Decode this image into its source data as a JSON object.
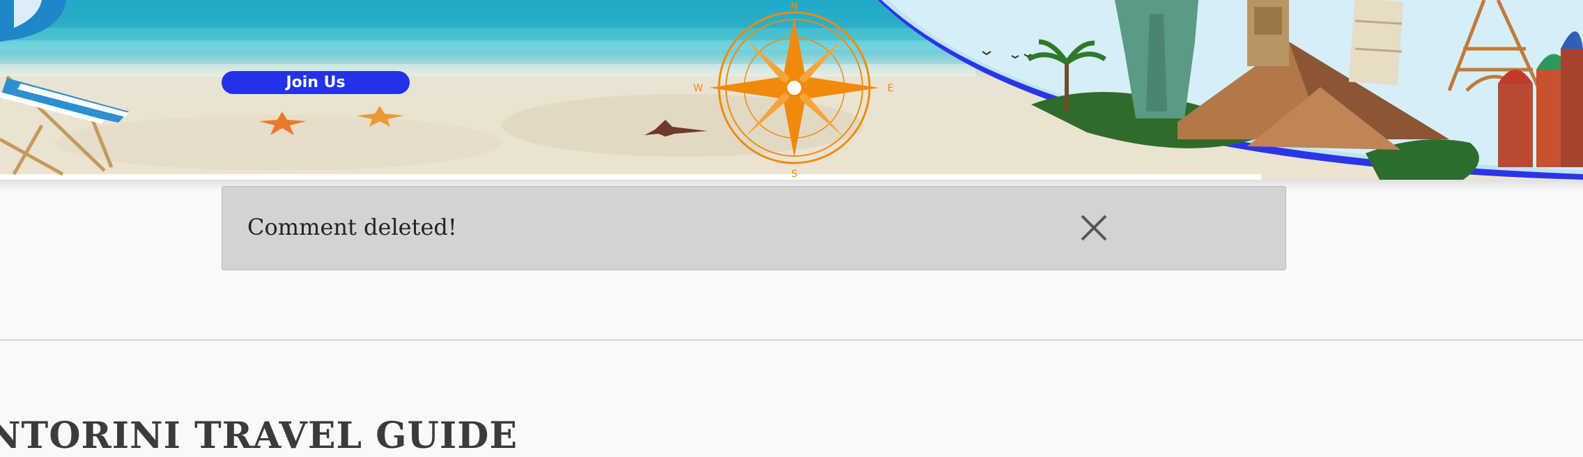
{
  "banner": {
    "join_label": "Join Us",
    "compass": {
      "north": "N",
      "south": "S",
      "east": "E",
      "west": "W"
    },
    "colors": {
      "join_button": "#2332e6",
      "compass": "#f08a0c",
      "arc": "#2a35e8"
    }
  },
  "alert": {
    "message": "Comment deleted!",
    "close_icon": "close-icon"
  },
  "page": {
    "heading": "NTORINI TRAVEL GUIDE"
  }
}
